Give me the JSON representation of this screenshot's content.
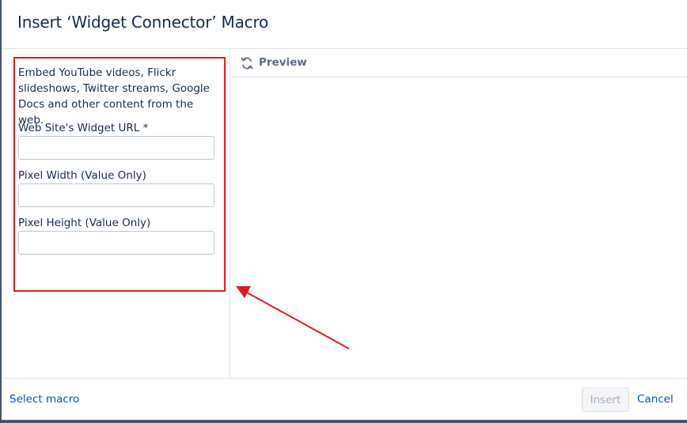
{
  "dialog": {
    "title": "Insert ‘Widget Connector’ Macro"
  },
  "form": {
    "description": "Embed YouTube videos, Flickr slideshows, Twitter streams, Google Docs and other content from the web.",
    "fields": [
      {
        "label": "Web Site's Widget URL *",
        "value": "",
        "placeholder": ""
      },
      {
        "label": "Pixel Width (Value Only)",
        "value": "",
        "placeholder": ""
      },
      {
        "label": "Pixel Height (Value Only)",
        "value": "",
        "placeholder": ""
      }
    ]
  },
  "preview": {
    "label": "Preview",
    "icon": "refresh-icon"
  },
  "footer": {
    "select_macro": "Select macro",
    "insert": "Insert",
    "cancel": "Cancel"
  },
  "colors": {
    "annotation": "#e01b24",
    "link": "#0052cc",
    "backdrop": "#44546f"
  }
}
